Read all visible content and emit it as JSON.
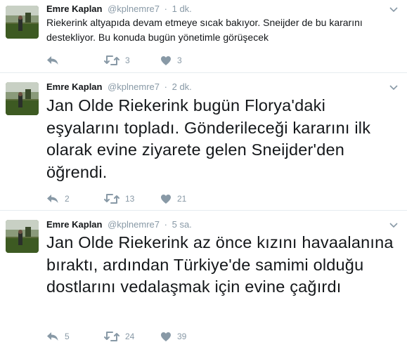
{
  "tweets": [
    {
      "name": "Emre Kaplan",
      "handle": "@kplnemre7",
      "separator": "·",
      "time": "1 dk.",
      "text": "Riekerink altyapıda devam etmeye sıcak bakıyor. Sneijder de bu kararını destekliyor. Bu konuda bugün yönetimle görüşecek",
      "replies": "",
      "retweets": "3",
      "likes": "3"
    },
    {
      "name": "Emre Kaplan",
      "handle": "@kplnemre7",
      "separator": "·",
      "time": "2 dk.",
      "text": "Jan Olde Riekerink bugün Florya'daki eşyalarını topladı. Gönderileceği kararını ilk olarak evine ziyarete gelen Sneijder'den öğrendi.",
      "replies": "2",
      "retweets": "13",
      "likes": "21"
    },
    {
      "name": "Emre Kaplan",
      "handle": "@kplnemre7",
      "separator": "·",
      "time": "5 sa.",
      "text": "Jan Olde Riekerink az önce kızını havaalanına bıraktı, ardından Türkiye'de samimi olduğu dostlarını vedalaşmak için evine çağırdı",
      "replies": "5",
      "retweets": "24",
      "likes": "39"
    }
  ],
  "colors": {
    "text": "#14171a",
    "meta": "#8899a6",
    "divider": "#e6ecf0"
  },
  "icons": [
    "avatar-photo",
    "chevron-down-icon",
    "reply-icon",
    "retweet-icon",
    "heart-icon"
  ]
}
